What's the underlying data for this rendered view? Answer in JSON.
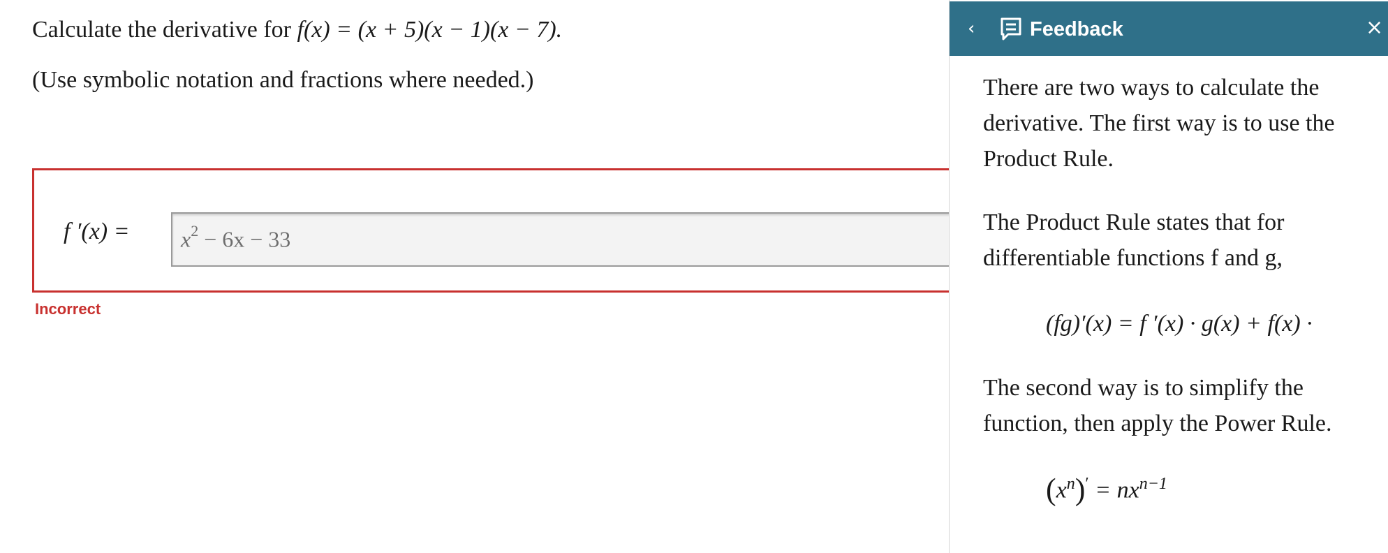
{
  "question": {
    "prefix": "Calculate the derivative for ",
    "function": "f(x) = (x + 5)(x − 1)(x − 7).",
    "instructions": "(Use symbolic notation and fractions where needed.)"
  },
  "answer": {
    "label": "f ′(x) =",
    "value_base": "x",
    "value_exp": "2",
    "value_rest": " − 6x − 33",
    "status": "Incorrect"
  },
  "feedback": {
    "title": "Feedback",
    "back_glyph": "‹",
    "close_glyph": "×",
    "p1": "There are two ways to calculate the derivative. The first way is to use the Product Rule.",
    "p2": "The Product Rule states that for differentiable functions f and g,",
    "formula1": "(fg)′(x) = f ′(x) · g(x) + f(x) ·",
    "p3": "The second way is to simplify the function, then apply the Power Rule.",
    "formula2_lhs": "x",
    "formula2_lhs_exp": "n",
    "formula2_eq": " = nx",
    "formula2_rhs_exp": "n−1"
  },
  "colors": {
    "header_bg": "#2f7089",
    "error": "#c8312f"
  }
}
